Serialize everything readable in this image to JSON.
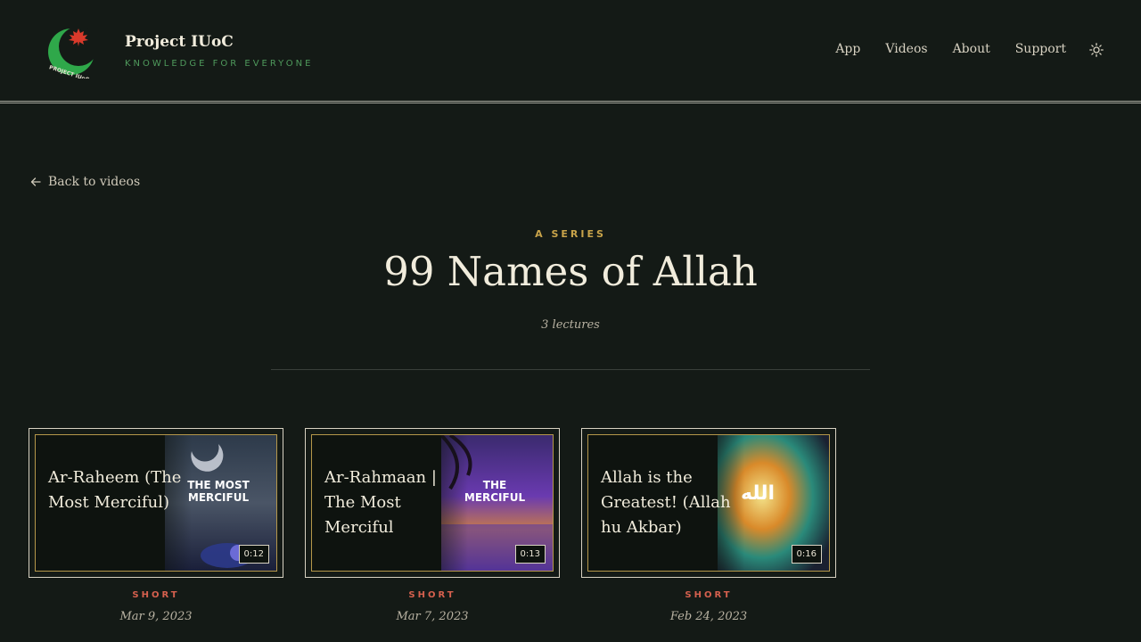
{
  "brand": {
    "name": "Project IUoC",
    "tagline": "KNOWLEDGE FOR EVERYONE",
    "logo_icon": "crescent-maple-leaf-logo",
    "logo_text": "PROJECT IUoC"
  },
  "nav": {
    "items": [
      {
        "label": "App"
      },
      {
        "label": "Videos"
      },
      {
        "label": "About"
      },
      {
        "label": "Support"
      }
    ],
    "theme_icon": "sun-icon"
  },
  "back_link": {
    "label": "Back to videos",
    "icon": "arrow-left-icon"
  },
  "series": {
    "kicker": "A SERIES",
    "title": "99 Names of Allah",
    "count": "3 lectures"
  },
  "videos": [
    {
      "title": "Ar-Raheem (The Most Merciful)",
      "duration": "0:12",
      "kind": "SHORT",
      "date": "Mar 9, 2023",
      "thumb_text": "THE MOST MERCIFUL"
    },
    {
      "title": "Ar-Rahmaan | The Most Merciful",
      "duration": "0:13",
      "kind": "SHORT",
      "date": "Mar 7, 2023",
      "thumb_text": "THE MERCIFUL"
    },
    {
      "title": "Allah is the Greatest! (Allah hu Akbar)",
      "duration": "0:16",
      "kind": "SHORT",
      "date": "Feb 24, 2023",
      "thumb_text": "الله"
    }
  ],
  "colors": {
    "background": "#141a16",
    "accent_gold": "#c9a44a",
    "accent_green": "#4f9a5c",
    "accent_red": "#d5604e"
  }
}
